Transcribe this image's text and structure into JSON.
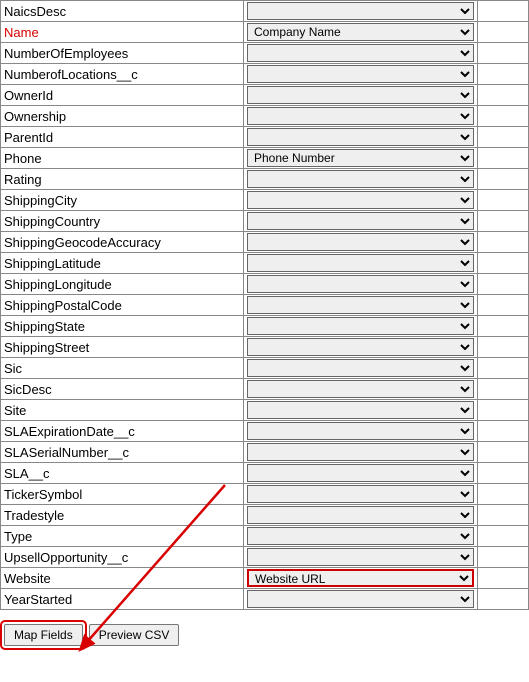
{
  "rows": [
    {
      "label": "NaicsDesc",
      "value": "",
      "required": false,
      "highlight": false
    },
    {
      "label": "Name",
      "value": "Company Name",
      "required": true,
      "highlight": false
    },
    {
      "label": "NumberOfEmployees",
      "value": "",
      "required": false,
      "highlight": false
    },
    {
      "label": "NumberofLocations__c",
      "value": "",
      "required": false,
      "highlight": false
    },
    {
      "label": "OwnerId",
      "value": "",
      "required": false,
      "highlight": false
    },
    {
      "label": "Ownership",
      "value": "",
      "required": false,
      "highlight": false
    },
    {
      "label": "ParentId",
      "value": "",
      "required": false,
      "highlight": false
    },
    {
      "label": "Phone",
      "value": "Phone Number",
      "required": false,
      "highlight": false
    },
    {
      "label": "Rating",
      "value": "",
      "required": false,
      "highlight": false
    },
    {
      "label": "ShippingCity",
      "value": "",
      "required": false,
      "highlight": false
    },
    {
      "label": "ShippingCountry",
      "value": "",
      "required": false,
      "highlight": false
    },
    {
      "label": "ShippingGeocodeAccuracy",
      "value": "",
      "required": false,
      "highlight": false
    },
    {
      "label": "ShippingLatitude",
      "value": "",
      "required": false,
      "highlight": false
    },
    {
      "label": "ShippingLongitude",
      "value": "",
      "required": false,
      "highlight": false
    },
    {
      "label": "ShippingPostalCode",
      "value": "",
      "required": false,
      "highlight": false
    },
    {
      "label": "ShippingState",
      "value": "",
      "required": false,
      "highlight": false
    },
    {
      "label": "ShippingStreet",
      "value": "",
      "required": false,
      "highlight": false
    },
    {
      "label": "Sic",
      "value": "",
      "required": false,
      "highlight": false
    },
    {
      "label": "SicDesc",
      "value": "",
      "required": false,
      "highlight": false
    },
    {
      "label": "Site",
      "value": "",
      "required": false,
      "highlight": false
    },
    {
      "label": "SLAExpirationDate__c",
      "value": "",
      "required": false,
      "highlight": false
    },
    {
      "label": "SLASerialNumber__c",
      "value": "",
      "required": false,
      "highlight": false
    },
    {
      "label": "SLA__c",
      "value": "",
      "required": false,
      "highlight": false
    },
    {
      "label": "TickerSymbol",
      "value": "",
      "required": false,
      "highlight": false
    },
    {
      "label": "Tradestyle",
      "value": "",
      "required": false,
      "highlight": false
    },
    {
      "label": "Type",
      "value": "",
      "required": false,
      "highlight": false
    },
    {
      "label": "UpsellOpportunity__c",
      "value": "",
      "required": false,
      "highlight": false
    },
    {
      "label": "Website",
      "value": "Website URL",
      "required": false,
      "highlight": true
    },
    {
      "label": "YearStarted",
      "value": "",
      "required": false,
      "highlight": false
    }
  ],
  "buttons": {
    "map_fields": "Map Fields",
    "preview_csv": "Preview CSV"
  },
  "select_options": [
    "",
    "Company Name",
    "Phone Number",
    "Website URL"
  ]
}
